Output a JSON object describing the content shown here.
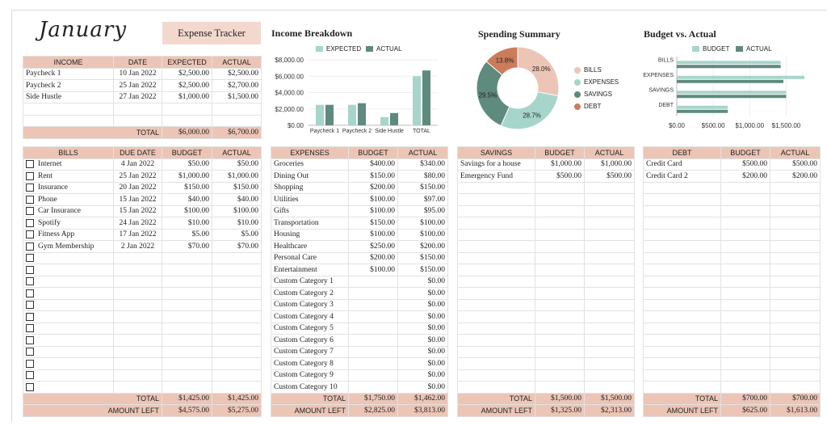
{
  "header": {
    "month": "January",
    "button": "Expense Tracker"
  },
  "colors": {
    "expected": "#a7d5cb",
    "actual": "#5f8a7e",
    "bills": "#ecc5b6",
    "expenses": "#a7d5cb",
    "savings": "#5f8a7e",
    "debt": "#cc7c5a",
    "header_fill": "#ecc5b6"
  },
  "income": {
    "headers": [
      "INCOME",
      "DATE",
      "EXPECTED",
      "ACTUAL"
    ],
    "rows": [
      [
        "Paycheck 1",
        "10 Jan 2022",
        "$2,500.00",
        "$2,500.00"
      ],
      [
        "Paycheck 2",
        "25 Jan 2022",
        "$2,500.00",
        "$2,700.00"
      ],
      [
        "Side Hustle",
        "27 Jan 2022",
        "$1,000.00",
        "$1,500.00"
      ],
      [
        "",
        "",
        "",
        ""
      ],
      [
        "",
        "",
        "",
        ""
      ]
    ],
    "total_label": "TOTAL",
    "total_expected": "$6,000.00",
    "total_actual": "$6,700.00"
  },
  "income_chart": {
    "title": "Income Breakdown",
    "legend": [
      "EXPECTED",
      "ACTUAL"
    ],
    "yticks": [
      "$8,000.00",
      "$6,000.00",
      "$4,000.00",
      "$2,000.00",
      "$0.00"
    ]
  },
  "spending_summary": {
    "title": "Spending Summary",
    "legend": [
      "BILLS",
      "EXPENSES",
      "SAVINGS",
      "DEBT"
    ],
    "labels": [
      "28.0%",
      "28.7%",
      "29.5%",
      "13.8%"
    ]
  },
  "budget_chart": {
    "title": "Budget vs. Actual",
    "legend": [
      "BUDGET",
      "ACTUAL"
    ],
    "categories": [
      "BILLS",
      "EXPENSES",
      "SAVINGS",
      "DEBT"
    ],
    "xticks": [
      "$0.00",
      "$500.00",
      "$1,000.00",
      "$1,500.00"
    ]
  },
  "chart_data": [
    {
      "type": "bar",
      "title": "Income Breakdown",
      "categories": [
        "Paycheck 1",
        "Paycheck 2",
        "Side Hustle",
        "TOTAL"
      ],
      "series": [
        {
          "name": "EXPECTED",
          "values": [
            2500,
            2500,
            1000,
            6000
          ]
        },
        {
          "name": "ACTUAL",
          "values": [
            2500,
            2700,
            1500,
            6700
          ]
        }
      ],
      "ylim": [
        0,
        8000
      ]
    },
    {
      "type": "pie",
      "title": "Spending Summary",
      "categories": [
        "BILLS",
        "EXPENSES",
        "SAVINGS",
        "DEBT"
      ],
      "values": [
        28.0,
        28.7,
        29.5,
        13.8
      ]
    },
    {
      "type": "bar",
      "title": "Budget vs. Actual",
      "categories": [
        "BILLS",
        "EXPENSES",
        "SAVINGS",
        "DEBT"
      ],
      "series": [
        {
          "name": "BUDGET",
          "values": [
            1425,
            1750,
            1500,
            700
          ]
        },
        {
          "name": "ACTUAL",
          "values": [
            1425,
            1462,
            1500,
            700
          ]
        }
      ],
      "xlim": [
        0,
        1750
      ]
    }
  ],
  "bills": {
    "headers": [
      "BILLS",
      "DUE DATE",
      "BUDGET",
      "ACTUAL"
    ],
    "rows": [
      [
        "Internet",
        "4 Jan 2022",
        "$50.00",
        "$50.00"
      ],
      [
        "Rent",
        "25 Jan 2022",
        "$1,000.00",
        "$1,000.00"
      ],
      [
        "Insurance",
        "20 Jan 2022",
        "$150.00",
        "$150.00"
      ],
      [
        "Phone",
        "15 Jan 2022",
        "$40.00",
        "$40.00"
      ],
      [
        "Car Insurance",
        "15 Jan 2022",
        "$100.00",
        "$100.00"
      ],
      [
        "Spotify",
        "24 Jan 2022",
        "$10.00",
        "$10.00"
      ],
      [
        "Fitness App",
        "17 Jan 2022",
        "$5.00",
        "$5.00"
      ],
      [
        "Gym Membership",
        "2 Jan 2022",
        "$70.00",
        "$70.00"
      ],
      [
        "",
        "",
        "",
        ""
      ],
      [
        "",
        "",
        "",
        ""
      ],
      [
        "",
        "",
        "",
        ""
      ],
      [
        "",
        "",
        "",
        ""
      ],
      [
        "",
        "",
        "",
        ""
      ],
      [
        "",
        "",
        "",
        ""
      ],
      [
        "",
        "",
        "",
        ""
      ],
      [
        "",
        "",
        "",
        ""
      ],
      [
        "",
        "",
        "",
        ""
      ],
      [
        "",
        "",
        "",
        ""
      ],
      [
        "",
        "",
        "",
        ""
      ],
      [
        "",
        "",
        "",
        ""
      ]
    ],
    "total_label": "TOTAL",
    "total_budget": "$1,425.00",
    "total_actual": "$1,425.00",
    "left_label": "AMOUNT LEFT",
    "left_budget": "$4,575.00",
    "left_actual": "$5,275.00"
  },
  "expenses": {
    "headers": [
      "EXPENSES",
      "BUDGET",
      "ACTUAL"
    ],
    "rows": [
      [
        "Groceries",
        "$400.00",
        "$340.00"
      ],
      [
        "Dining Out",
        "$150.00",
        "$80.00"
      ],
      [
        "Shopping",
        "$200.00",
        "$150.00"
      ],
      [
        "Utilities",
        "$100.00",
        "$97.00"
      ],
      [
        "Gifts",
        "$100.00",
        "$95.00"
      ],
      [
        "Transportation",
        "$150.00",
        "$100.00"
      ],
      [
        "Housing",
        "$100.00",
        "$100.00"
      ],
      [
        "Healthcare",
        "$250.00",
        "$200.00"
      ],
      [
        "Personal Care",
        "$200.00",
        "$150.00"
      ],
      [
        "Entertainment",
        "$100.00",
        "$150.00"
      ],
      [
        "Custom Category 1",
        "",
        "$0.00"
      ],
      [
        "Custom Category 2",
        "",
        "$0.00"
      ],
      [
        "Custom Category 3",
        "",
        "$0.00"
      ],
      [
        "Custom Category 4",
        "",
        "$0.00"
      ],
      [
        "Custom Category 5",
        "",
        "$0.00"
      ],
      [
        "Custom Category 6",
        "",
        "$0.00"
      ],
      [
        "Custom Category 7",
        "",
        "$0.00"
      ],
      [
        "Custom Category 8",
        "",
        "$0.00"
      ],
      [
        "Custom Category 9",
        "",
        "$0.00"
      ],
      [
        "Custom Category 10",
        "",
        "$0.00"
      ]
    ],
    "total_label": "TOTAL",
    "total_budget": "$1,750.00",
    "total_actual": "$1,462.00",
    "left_label": "AMOUNT LEFT",
    "left_budget": "$2,825.00",
    "left_actual": "$3,813.00"
  },
  "savings": {
    "headers": [
      "SAVINGS",
      "BUDGET",
      "ACTUAL"
    ],
    "rows": [
      [
        "Savings for a house",
        "$1,000.00",
        "$1,000.00"
      ],
      [
        "Emergency Fund",
        "$500.00",
        "$500.00"
      ],
      [
        "",
        "",
        ""
      ],
      [
        "",
        "",
        ""
      ],
      [
        "",
        "",
        ""
      ],
      [
        "",
        "",
        ""
      ],
      [
        "",
        "",
        ""
      ],
      [
        "",
        "",
        ""
      ],
      [
        "",
        "",
        ""
      ],
      [
        "",
        "",
        ""
      ],
      [
        "",
        "",
        ""
      ],
      [
        "",
        "",
        ""
      ],
      [
        "",
        "",
        ""
      ],
      [
        "",
        "",
        ""
      ],
      [
        "",
        "",
        ""
      ],
      [
        "",
        "",
        ""
      ],
      [
        "",
        "",
        ""
      ],
      [
        "",
        "",
        ""
      ],
      [
        "",
        "",
        ""
      ],
      [
        "",
        "",
        ""
      ]
    ],
    "total_label": "TOTAL",
    "total_budget": "$1,500.00",
    "total_actual": "$1,500.00",
    "left_label": "AMOUNT LEFT",
    "left_budget": "$1,325.00",
    "left_actual": "$2,313.00"
  },
  "debt": {
    "headers": [
      "DEBT",
      "BUDGET",
      "ACTUAL"
    ],
    "rows": [
      [
        "Credit Card",
        "$500.00",
        "$500.00"
      ],
      [
        "Credit Card 2",
        "$200.00",
        "$200.00"
      ],
      [
        "",
        "",
        ""
      ],
      [
        "",
        "",
        ""
      ],
      [
        "",
        "",
        ""
      ],
      [
        "",
        "",
        ""
      ],
      [
        "",
        "",
        ""
      ],
      [
        "",
        "",
        ""
      ],
      [
        "",
        "",
        ""
      ],
      [
        "",
        "",
        ""
      ],
      [
        "",
        "",
        ""
      ],
      [
        "",
        "",
        ""
      ],
      [
        "",
        "",
        ""
      ],
      [
        "",
        "",
        ""
      ],
      [
        "",
        "",
        ""
      ],
      [
        "",
        "",
        ""
      ],
      [
        "",
        "",
        ""
      ],
      [
        "",
        "",
        ""
      ],
      [
        "",
        "",
        ""
      ],
      [
        "",
        "",
        ""
      ]
    ],
    "total_label": "TOTAL",
    "total_budget": "$700.00",
    "total_actual": "$700.00",
    "left_label": "AMOUNT LEFT",
    "left_budget": "$625.00",
    "left_actual": "$1,613.00"
  }
}
